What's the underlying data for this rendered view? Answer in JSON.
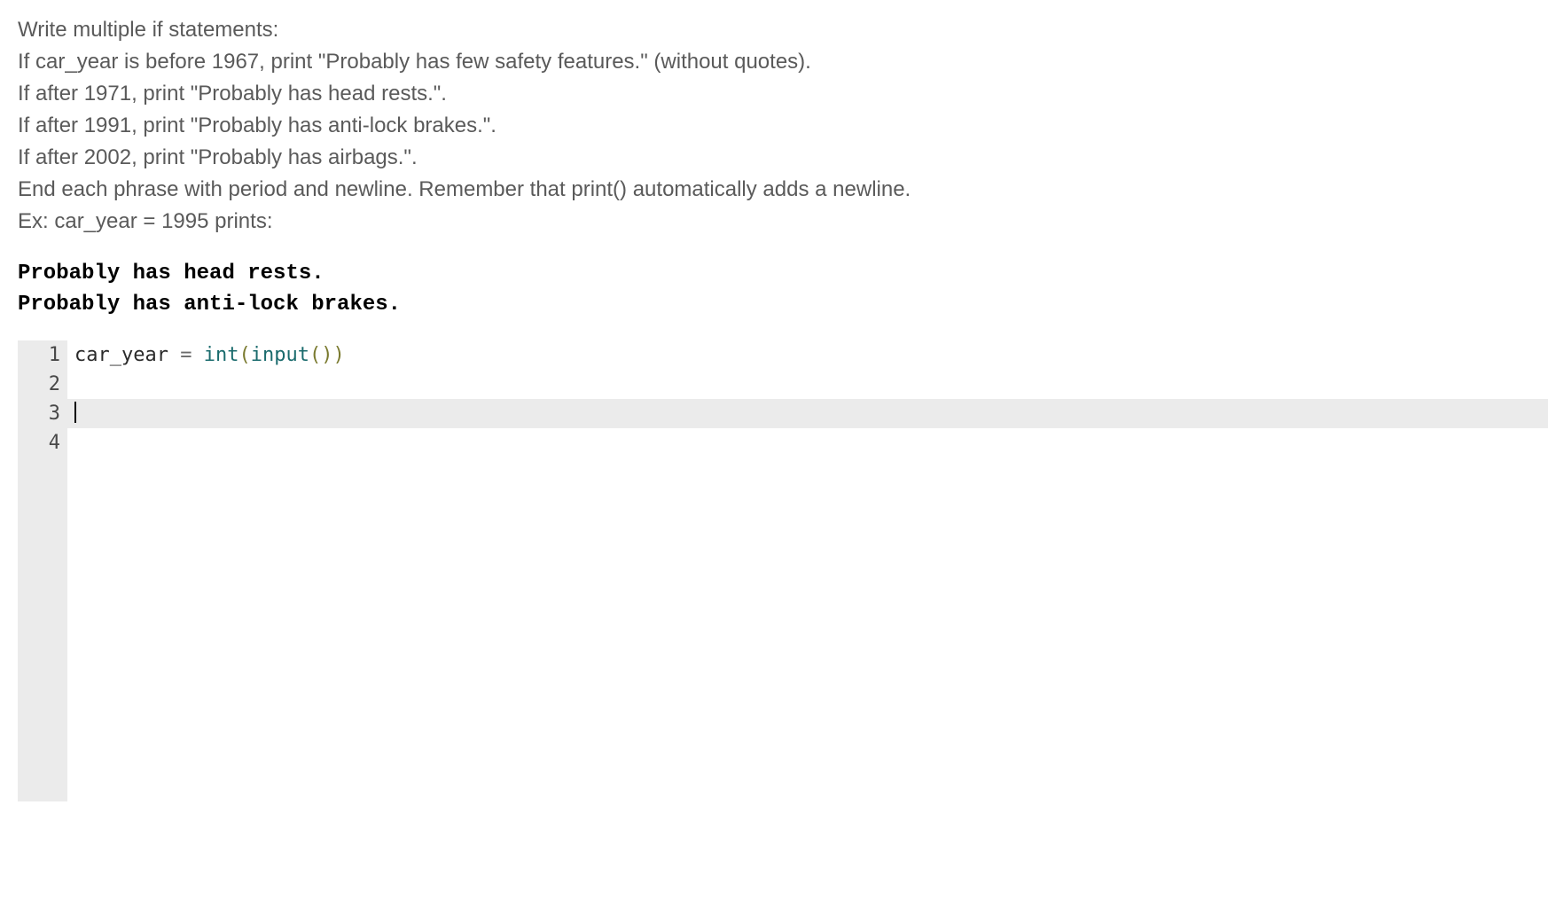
{
  "problem": {
    "lines": [
      "Write multiple if statements:",
      "If car_year is before 1967, print \"Probably has few safety features.\" (without quotes).",
      "If after 1971, print \"Probably has head rests.\".",
      "If after 1991, print \"Probably has anti-lock brakes.\".",
      "If after 2002, print \"Probably has airbags.\".",
      "End each phrase with period and newline. Remember that print() automatically adds a newline.",
      "Ex: car_year = 1995 prints:"
    ]
  },
  "example_output": [
    "Probably has head rests.",
    "Probably has anti-lock brakes."
  ],
  "editor": {
    "line_numbers": [
      "1",
      "2",
      "3",
      "4"
    ],
    "active_line": 3,
    "code": {
      "line1": {
        "tok_id1": "car_year",
        "tok_sp1": " ",
        "tok_eq": "=",
        "tok_sp2": " ",
        "tok_int": "int",
        "tok_lp1": "(",
        "tok_input": "input",
        "tok_lp2": "(",
        "tok_rp1": ")",
        "tok_rp2": ")"
      },
      "line2": "",
      "line3": "",
      "line4": ""
    }
  }
}
